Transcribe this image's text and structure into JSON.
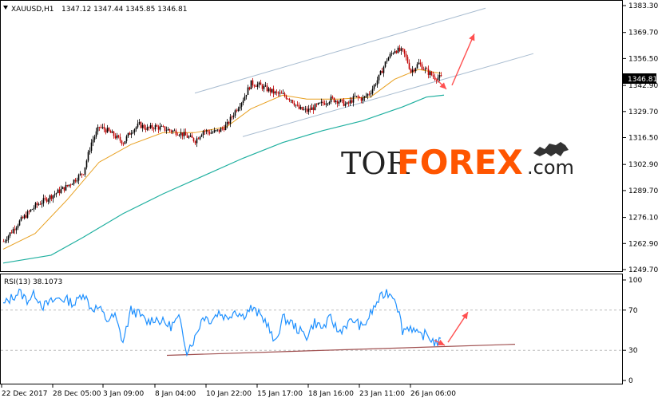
{
  "header": {
    "symbol": "XAUUSD,H1",
    "ohlc": "1347.12 1347.44 1345.85 1346.81"
  },
  "price_tag": "1346.81",
  "rsi_label": "RSI(13) 38.1073",
  "watermark": {
    "tor": "TOR",
    "forex": "FOREX",
    "com": ".com"
  },
  "colors": {
    "bull_candle": "#000000",
    "bear_candle": "#c00000",
    "ma_fast": "#e8a020",
    "ma_slow": "#20b0a0",
    "rsi": "#1e90ff",
    "channel": "#a8bcd0",
    "arrow": "#ff5050",
    "trendline": "#a05050",
    "watermark_orange": "#ff5500",
    "watermark_dark": "#222222"
  },
  "chart_data": [
    {
      "type": "candlestick",
      "symbol": "XAUUSD",
      "timeframe": "H1",
      "y_ticks": [
        1383.3,
        1369.7,
        1356.5,
        1342.9,
        1329.7,
        1316.5,
        1302.9,
        1289.7,
        1276.1,
        1262.9,
        1249.7
      ],
      "ylim": [
        1249.7,
        1383.3
      ],
      "x_ticks": [
        "22 Dec 2017",
        "28 Dec 05:00",
        "3 Jan 09:00",
        "8 Jan 04:00",
        "10 Jan 22:00",
        "15 Jan 17:00",
        "18 Jan 16:00",
        "23 Jan 11:00",
        "26 Jan 06:00"
      ],
      "close_path": [
        [
          0,
          1264
        ],
        [
          20,
          1274
        ],
        [
          40,
          1282
        ],
        [
          60,
          1287
        ],
        [
          80,
          1292
        ],
        [
          100,
          1299
        ],
        [
          110,
          1314
        ],
        [
          120,
          1322
        ],
        [
          130,
          1320
        ],
        [
          140,
          1317
        ],
        [
          150,
          1314
        ],
        [
          160,
          1320
        ],
        [
          170,
          1323
        ],
        [
          180,
          1321
        ],
        [
          190,
          1322
        ],
        [
          200,
          1321
        ],
        [
          210,
          1320
        ],
        [
          220,
          1319
        ],
        [
          230,
          1317
        ],
        [
          240,
          1315
        ],
        [
          250,
          1320
        ],
        [
          260,
          1319
        ],
        [
          270,
          1320
        ],
        [
          280,
          1323
        ],
        [
          290,
          1330
        ],
        [
          300,
          1336
        ],
        [
          310,
          1344
        ],
        [
          320,
          1343
        ],
        [
          330,
          1341
        ],
        [
          340,
          1339
        ],
        [
          350,
          1338
        ],
        [
          360,
          1336
        ],
        [
          370,
          1331
        ],
        [
          380,
          1330
        ],
        [
          390,
          1332
        ],
        [
          400,
          1334
        ],
        [
          410,
          1336
        ],
        [
          420,
          1335
        ],
        [
          430,
          1333
        ],
        [
          440,
          1337
        ],
        [
          450,
          1336
        ],
        [
          460,
          1340
        ],
        [
          470,
          1347
        ],
        [
          480,
          1356
        ],
        [
          490,
          1361
        ],
        [
          500,
          1360
        ],
        [
          505,
          1356
        ],
        [
          510,
          1350
        ],
        [
          515,
          1352
        ],
        [
          520,
          1354
        ],
        [
          530,
          1350
        ],
        [
          540,
          1347
        ],
        [
          548,
          1346.81
        ]
      ],
      "ma_fast": [
        [
          0,
          1260
        ],
        [
          40,
          1268
        ],
        [
          80,
          1285
        ],
        [
          120,
          1304
        ],
        [
          160,
          1313
        ],
        [
          200,
          1319
        ],
        [
          240,
          1319
        ],
        [
          280,
          1322
        ],
        [
          310,
          1331
        ],
        [
          350,
          1338
        ],
        [
          380,
          1336
        ],
        [
          420,
          1336
        ],
        [
          460,
          1337
        ],
        [
          490,
          1346
        ],
        [
          520,
          1351
        ],
        [
          548,
          1349
        ]
      ],
      "ma_slow": [
        [
          0,
          1253
        ],
        [
          60,
          1257
        ],
        [
          100,
          1266
        ],
        [
          150,
          1278
        ],
        [
          200,
          1288
        ],
        [
          250,
          1297
        ],
        [
          300,
          1306
        ],
        [
          350,
          1314
        ],
        [
          400,
          1320
        ],
        [
          450,
          1325
        ],
        [
          500,
          1332
        ],
        [
          530,
          1337
        ],
        [
          552,
          1338
        ]
      ],
      "channel_upper": [
        [
          244,
          1339
        ],
        [
          608,
          1382
        ]
      ],
      "channel_lower": [
        [
          304,
          1317
        ],
        [
          668,
          1359
        ]
      ],
      "forecast_arrows": [
        {
          "from": [
            540,
            1347
          ],
          "to": [
            555,
            1341
          ]
        },
        {
          "from": [
            562,
            1343
          ],
          "to": [
            590,
            1369
          ]
        }
      ]
    },
    {
      "type": "line",
      "name": "RSI(13)",
      "value": 38.1073,
      "y_ticks": [
        100,
        70,
        30,
        0
      ],
      "ylim": [
        0,
        100
      ],
      "values": [
        [
          0,
          75
        ],
        [
          10,
          82
        ],
        [
          20,
          88
        ],
        [
          30,
          80
        ],
        [
          40,
          86
        ],
        [
          50,
          74
        ],
        [
          60,
          78
        ],
        [
          70,
          82
        ],
        [
          80,
          80
        ],
        [
          90,
          76
        ],
        [
          100,
          88
        ],
        [
          110,
          72
        ],
        [
          120,
          72
        ],
        [
          130,
          60
        ],
        [
          140,
          64
        ],
        [
          150,
          38
        ],
        [
          160,
          70
        ],
        [
          170,
          66
        ],
        [
          180,
          58
        ],
        [
          190,
          62
        ],
        [
          200,
          58
        ],
        [
          210,
          54
        ],
        [
          220,
          62
        ],
        [
          230,
          30
        ],
        [
          240,
          42
        ],
        [
          250,
          64
        ],
        [
          260,
          60
        ],
        [
          270,
          68
        ],
        [
          280,
          62
        ],
        [
          290,
          70
        ],
        [
          300,
          64
        ],
        [
          310,
          72
        ],
        [
          320,
          66
        ],
        [
          330,
          58
        ],
        [
          340,
          36
        ],
        [
          350,
          62
        ],
        [
          360,
          58
        ],
        [
          370,
          50
        ],
        [
          380,
          44
        ],
        [
          390,
          58
        ],
        [
          400,
          52
        ],
        [
          410,
          62
        ],
        [
          420,
          48
        ],
        [
          430,
          56
        ],
        [
          440,
          60
        ],
        [
          450,
          52
        ],
        [
          460,
          66
        ],
        [
          470,
          80
        ],
        [
          480,
          88
        ],
        [
          490,
          84
        ],
        [
          495,
          70
        ],
        [
          500,
          50
        ],
        [
          510,
          54
        ],
        [
          520,
          44
        ],
        [
          530,
          46
        ],
        [
          540,
          38
        ],
        [
          548,
          38
        ]
      ],
      "trendline": [
        [
          209,
          25
        ],
        [
          645,
          36
        ]
      ],
      "forecast_arrows": [
        {
          "from": [
            540,
            40
          ],
          "to": [
            553,
            35
          ]
        },
        {
          "from": [
            557,
            38
          ],
          "to": [
            582,
            68
          ]
        }
      ]
    }
  ]
}
